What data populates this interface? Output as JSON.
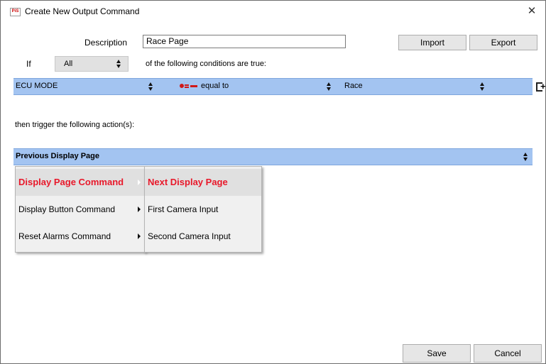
{
  "window": {
    "title": "Create New Output Command",
    "app_icon_text": "PiS",
    "close_glyph": "✕"
  },
  "form": {
    "description_label": "Description",
    "description_value": "Race Page",
    "import_label": "Import",
    "export_label": "Export",
    "if_label": "If",
    "match_value": "All",
    "conditions_text": "of the following conditions are true:"
  },
  "condition": {
    "channel": "ECU MODE",
    "operator": "equal to",
    "value": "Race",
    "add_glyph": "+"
  },
  "actions": {
    "label": "then trigger the following action(s):",
    "selected": "Previous Display Page"
  },
  "menu": {
    "categories": [
      {
        "label": "Display Page Command",
        "selected": true
      },
      {
        "label": "Display Button Command",
        "selected": false
      },
      {
        "label": "Reset Alarms Command",
        "selected": false
      }
    ],
    "submenu": [
      {
        "label": "Next Display Page",
        "selected": true
      },
      {
        "label": "First Camera Input",
        "selected": false
      },
      {
        "label": "Second Camera Input",
        "selected": false
      }
    ]
  },
  "footer": {
    "save_label": "Save",
    "cancel_label": "Cancel"
  },
  "colors": {
    "bar": "#a3c4f1",
    "highlight_text": "#e8182a",
    "operator_icon": "#d01818"
  },
  "icons": {
    "close": "close-icon",
    "app": "app-logo-icon",
    "add_condition": "add-condition-icon",
    "operator": "equal-operator-icon"
  }
}
